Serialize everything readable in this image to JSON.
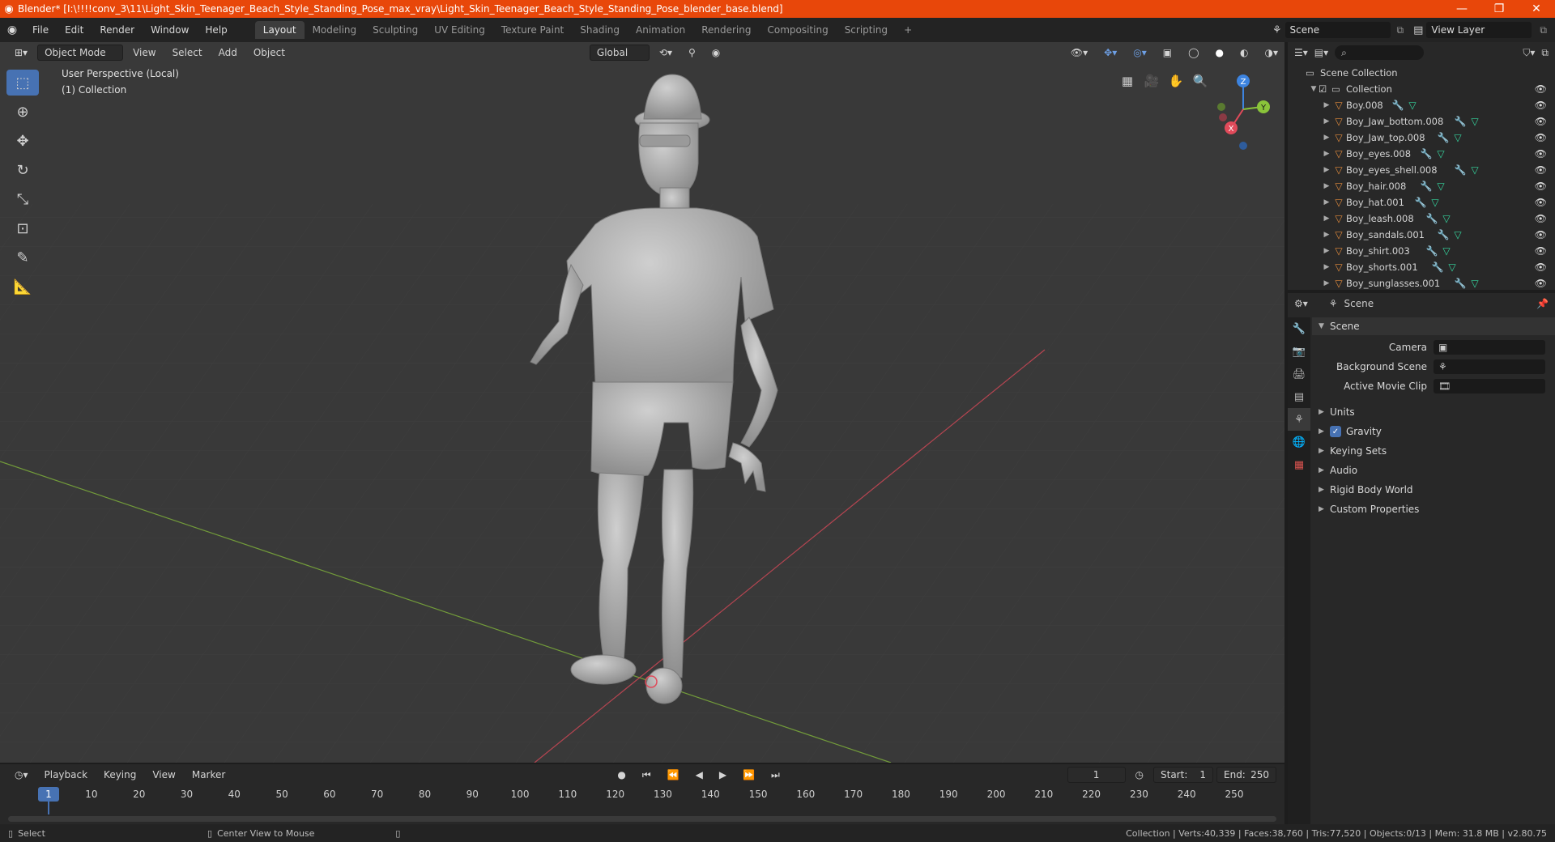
{
  "window": {
    "title": "Blender* [I:\\!!!!conv_3\\11\\Light_Skin_Teenager_Beach_Style_Standing_Pose_max_vray\\Light_Skin_Teenager_Beach_Style_Standing_Pose_blender_base.blend]",
    "minimize": "—",
    "maximize": "❐",
    "close": "✕"
  },
  "menu": [
    "File",
    "Edit",
    "Render",
    "Window",
    "Help"
  ],
  "workspaces": [
    "Layout",
    "Modeling",
    "Sculpting",
    "UV Editing",
    "Texture Paint",
    "Shading",
    "Animation",
    "Rendering",
    "Compositing",
    "Scripting"
  ],
  "workspace_add": "+",
  "scene_selector": "Scene",
  "view_layer_selector": "View Layer",
  "viewport": {
    "mode": "Object Mode",
    "menus": [
      "View",
      "Select",
      "Add",
      "Object"
    ],
    "orientation": "Global",
    "info_line1": "User Perspective (Local)",
    "info_line2": "(1) Collection",
    "gizmo": {
      "x": "X",
      "y": "Y",
      "z": "Z"
    }
  },
  "outliner": {
    "root": "Scene Collection",
    "collection": "Collection",
    "items": [
      "Boy.008",
      "Boy_Jaw_bottom.008",
      "Boy_Jaw_top.008",
      "Boy_eyes.008",
      "Boy_eyes_shell.008",
      "Boy_hair.008",
      "Boy_hat.001",
      "Boy_leash.008",
      "Boy_sandals.001",
      "Boy_shirt.003",
      "Boy_shorts.001",
      "Boy_sunglasses.001"
    ]
  },
  "properties": {
    "context": "Scene",
    "panel_title": "Scene",
    "fields": {
      "camera": "Camera",
      "background_scene": "Background Scene",
      "active_movie_clip": "Active Movie Clip"
    },
    "subpanels": [
      "Units",
      "Gravity",
      "Keying Sets",
      "Audio",
      "Rigid Body World",
      "Custom Properties"
    ],
    "gravity_checked": true
  },
  "timeline": {
    "menus": [
      "Playback",
      "Keying",
      "View",
      "Marker"
    ],
    "current_frame": "1",
    "start_label": "Start:",
    "start": "1",
    "end_label": "End:",
    "end": "250",
    "ticks": [
      "1",
      "10",
      "20",
      "30",
      "40",
      "50",
      "60",
      "70",
      "80",
      "90",
      "100",
      "110",
      "120",
      "130",
      "140",
      "150",
      "160",
      "170",
      "180",
      "190",
      "200",
      "210",
      "220",
      "230",
      "240",
      "250"
    ]
  },
  "status": {
    "select": "Select",
    "center_view": "Center View to Mouse",
    "stats": "Collection | Verts:40,339 | Faces:38,760 | Tris:77,520 | Objects:0/13 | Mem: 31.8 MB | v2.80.75"
  },
  "colors": {
    "titlebar": "#e8470a",
    "accent": "#4772b3",
    "viewport_bg": "#393939",
    "x_axis": "#e04a5a",
    "y_axis": "#8ac43a",
    "z_axis": "#3d84e0"
  }
}
